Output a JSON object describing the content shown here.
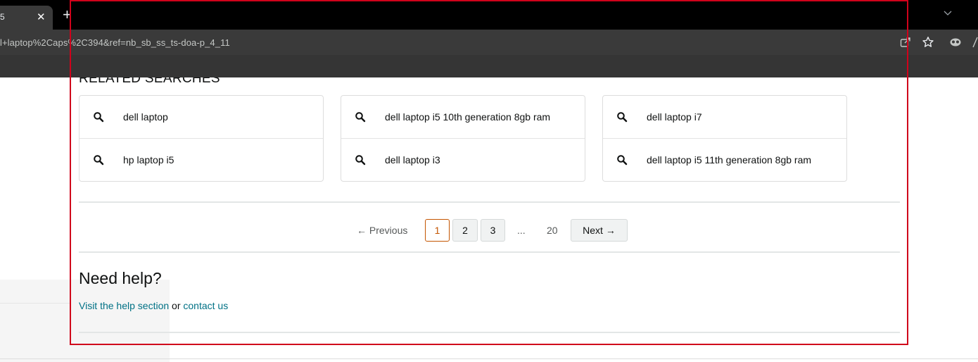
{
  "browser": {
    "tab_title": "5",
    "tab_close": "✕",
    "new_tab": "+",
    "url": "l+laptop%2Caps%2C394&ref=nb_sb_ss_ts-doa-p_4_11",
    "icons": [
      "share-icon",
      "star-icon",
      "extension-icon"
    ]
  },
  "related_searches": {
    "title": "RELATED SEARCHES",
    "items": [
      "dell laptop",
      "hp laptop i5",
      "dell laptop i5 10th generation 8gb ram",
      "dell laptop i3",
      "dell laptop i7",
      "dell laptop i5 11th generation 8gb ram"
    ]
  },
  "pagination": {
    "previous": "←  Previous",
    "pages": [
      "1",
      "2",
      "3"
    ],
    "ellipsis": "...",
    "last": "20",
    "next": "Next  →",
    "current": "1"
  },
  "help": {
    "title": "Need help?",
    "link1": "Visit the help section",
    "connector": " or ",
    "link2": "contact us"
  },
  "colors": {
    "link": "#007185",
    "current_page": "#c45500",
    "highlight_frame": "#d0021b"
  }
}
